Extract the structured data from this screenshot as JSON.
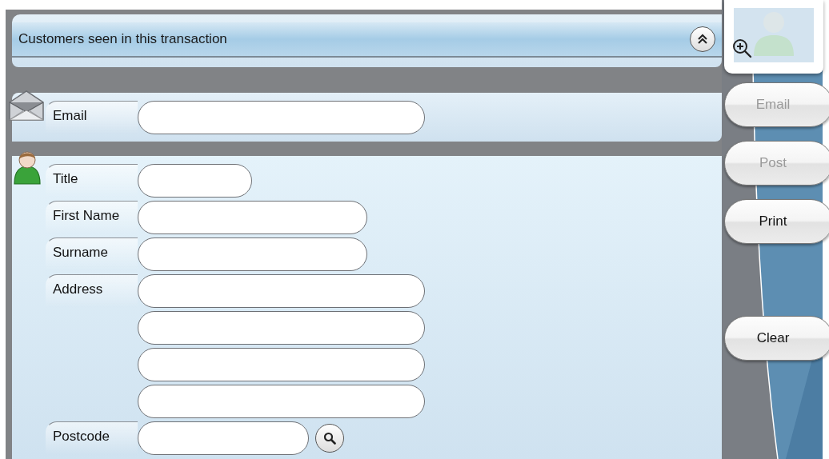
{
  "header": {
    "title": "Customers seen in this transaction"
  },
  "email_section": {
    "label": "Email"
  },
  "customer_section": {
    "rows": [
      {
        "kind": "short",
        "label": "Title"
      },
      {
        "kind": "medium",
        "label": "First Name"
      },
      {
        "kind": "medium",
        "label": "Surname"
      },
      {
        "kind": "long",
        "label": "Address"
      },
      {
        "kind": "long"
      },
      {
        "kind": "long"
      },
      {
        "kind": "long"
      },
      {
        "kind": "lookup",
        "label": "Postcode"
      }
    ]
  },
  "actions": [
    {
      "label": "Email",
      "disabled": true
    },
    {
      "label": "Post",
      "disabled": true
    },
    {
      "label": "Print",
      "disabled": false
    },
    {
      "label": "Clear",
      "disabled": false,
      "kind": "separated"
    }
  ]
}
